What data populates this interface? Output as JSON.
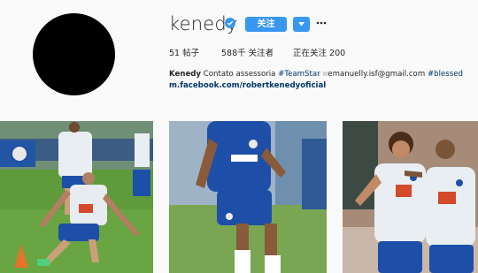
{
  "profile": {
    "username": "kenedy",
    "follow_label": "关注",
    "more_icon": "more-horizontal-icon",
    "verified_icon": "verified-badge-icon"
  },
  "stats": {
    "posts": "51",
    "posts_label": "帖子",
    "followers": "588千",
    "followers_label": "关注者",
    "following_label": "正在关注",
    "following": "200"
  },
  "bio": {
    "name": "Kenedy",
    "text1": "Contato assessoria",
    "tag1": "#TeamStar",
    "sep": "✉",
    "email": "emanuelly.isf@gmail.com",
    "tag2": "#blessed",
    "link": "m.facebook.com/robertkenedyoficial"
  },
  "colors": {
    "accent": "#3897f0",
    "link": "#003569",
    "pitch": "#5f9a3c",
    "chelsea_blue": "#1d4fa8"
  }
}
